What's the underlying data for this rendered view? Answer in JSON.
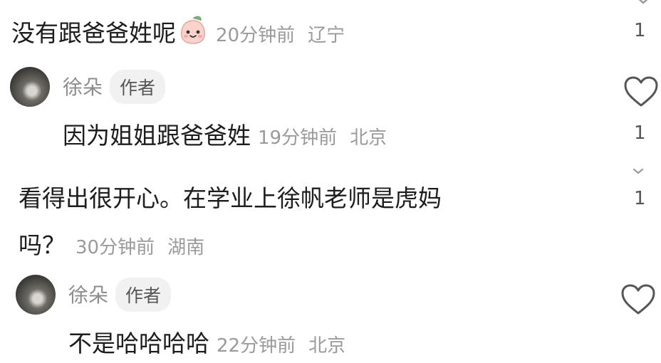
{
  "comments": [
    {
      "text": "没有跟爸爸姓呢",
      "emoji": "peach-face-emoji",
      "time": "20分钟前",
      "location": "辽宁",
      "likes": "1"
    },
    {
      "author": "徐朵",
      "badge": "作者",
      "text": "因为姐姐跟爸爸姓",
      "time": "19分钟前",
      "location": "北京",
      "likes": "1"
    },
    {
      "text_line1": "看得出很开心。在学业上徐帆老师是虎妈",
      "text_line2": "吗？",
      "time": "30分钟前",
      "location": "湖南",
      "likes": "1"
    },
    {
      "author": "徐朵",
      "badge": "作者",
      "text": "不是哈哈哈哈",
      "time": "22分钟前",
      "location": "北京"
    }
  ],
  "icons": {
    "like": "heart-outline-icon",
    "expand": "chevron-down-icon"
  }
}
